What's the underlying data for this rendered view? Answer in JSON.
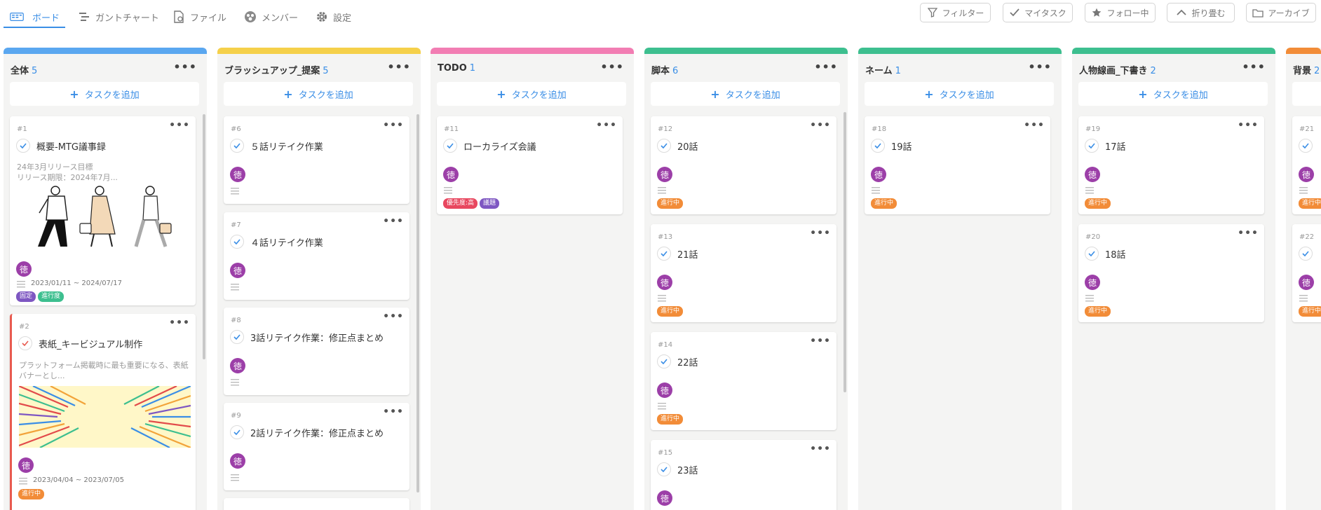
{
  "nav": {
    "tabs": [
      {
        "label": "ボード",
        "icon": "board-icon"
      },
      {
        "label": "ガントチャート",
        "icon": "gantt-icon"
      },
      {
        "label": "ファイル",
        "icon": "file-icon"
      },
      {
        "label": "メンバー",
        "icon": "member-icon"
      },
      {
        "label": "設定",
        "icon": "gear-icon"
      }
    ]
  },
  "toolbar": {
    "buttons": [
      {
        "label": "フィルター",
        "icon": "filter-icon"
      },
      {
        "label": "マイタスク",
        "icon": "check-icon"
      },
      {
        "label": "フォロー中",
        "icon": "star-icon"
      },
      {
        "label": "折り畳む",
        "icon": "chevron-up-icon"
      },
      {
        "label": "アーカイブ",
        "icon": "folder-icon"
      }
    ]
  },
  "add_task_label": "タスクを追加",
  "avatar_text": "徳",
  "colors": {
    "accent": "#3a8ee6",
    "tag_in_progress": "#f28c38",
    "tag_fixed": "#7e57c2",
    "tag_progress_rate": "#3dbf8f",
    "tag_priority_high": "#e8475f",
    "tag_issue": "#7e57c2"
  },
  "columns": [
    {
      "title": "全体",
      "count": "5",
      "color": "#5aa7f0",
      "cards": [
        {
          "id": "#1",
          "title": "概要-MTG議事録",
          "desc": [
            "24年3月リリース目標",
            "リリース期限：2024年7月..."
          ],
          "dates": "2023/01/11 ~ 2024/07/17",
          "tags": [
            {
              "label": "固定"
            },
            {
              "label": "進行度"
            }
          ]
        },
        {
          "id": "#2",
          "title": "表紙_キービジュアル制作",
          "desc": [
            "プラットフォーム掲載時に最も重要になる、表紙",
            "バナーとし..."
          ],
          "dates": "2023/04/04 ~ 2023/07/05",
          "tags": [
            {
              "label": "進行中"
            }
          ]
        }
      ]
    },
    {
      "title": "ブラッシュアップ_提案",
      "count": "5",
      "color": "#f5d04a",
      "cards": [
        {
          "id": "#6",
          "title": "５話リテイク作業"
        },
        {
          "id": "#7",
          "title": "４話リテイク作業"
        },
        {
          "id": "#8",
          "title": "3話リテイク作業：修正点まとめ"
        },
        {
          "id": "#9",
          "title": "2話リテイク作業：修正点まとめ"
        }
      ]
    },
    {
      "title": "TODO",
      "count": "1",
      "color": "#f27db3",
      "cards": [
        {
          "id": "#11",
          "title": "ローカライズ会議",
          "tags": [
            {
              "label": "優先度:高"
            },
            {
              "label": "議題"
            }
          ]
        }
      ]
    },
    {
      "title": "脚本",
      "count": "6",
      "color": "#3dbf8f",
      "cards": [
        {
          "id": "#12",
          "title": "20話",
          "tags": [
            {
              "label": "進行中"
            }
          ]
        },
        {
          "id": "#13",
          "title": "21話",
          "tags": [
            {
              "label": "進行中"
            }
          ]
        },
        {
          "id": "#14",
          "title": "22話",
          "tags": [
            {
              "label": "進行中"
            }
          ]
        },
        {
          "id": "#15",
          "title": "23話"
        }
      ]
    },
    {
      "title": "ネーム",
      "count": "1",
      "color": "#3dbf8f",
      "cards": [
        {
          "id": "#18",
          "title": "19話",
          "tags": [
            {
              "label": "進行中"
            }
          ]
        }
      ]
    },
    {
      "title": "人物線画_下書き",
      "count": "2",
      "color": "#3dbf8f",
      "cards": [
        {
          "id": "#19",
          "title": "17話",
          "tags": [
            {
              "label": "進行中"
            }
          ]
        },
        {
          "id": "#20",
          "title": "18話",
          "tags": [
            {
              "label": "進行中"
            }
          ]
        }
      ]
    },
    {
      "title": "背景",
      "count": "2",
      "color": "#f28c38",
      "cards": [
        {
          "id": "#21",
          "tags": [
            {
              "label": "進行中"
            }
          ]
        },
        {
          "id": "#22",
          "tags": [
            {
              "label": "進行中"
            }
          ]
        }
      ]
    }
  ]
}
